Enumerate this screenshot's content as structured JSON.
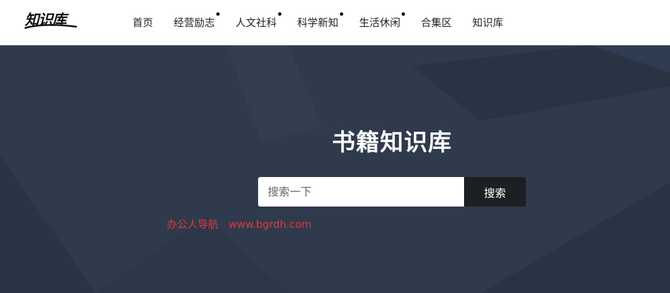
{
  "header": {
    "logo_text": "知识库",
    "nav": [
      {
        "label": "首页",
        "has_dot": false
      },
      {
        "label": "经营励志",
        "has_dot": true
      },
      {
        "label": "人文社科",
        "has_dot": true
      },
      {
        "label": "科学新知",
        "has_dot": true
      },
      {
        "label": "生活休闲",
        "has_dot": true
      },
      {
        "label": "合集区",
        "has_dot": false
      },
      {
        "label": "知识库",
        "has_dot": false
      }
    ]
  },
  "hero": {
    "title": "书籍知识库",
    "search": {
      "placeholder": "搜索一下",
      "value": "",
      "button_label": "搜索"
    },
    "watermark": {
      "name": "办公人导航",
      "url": "www.bgrdh.com"
    }
  },
  "colors": {
    "hero_bg": "#2f3a4c",
    "search_button_bg": "#1e1f22",
    "watermark": "#e0393e"
  }
}
